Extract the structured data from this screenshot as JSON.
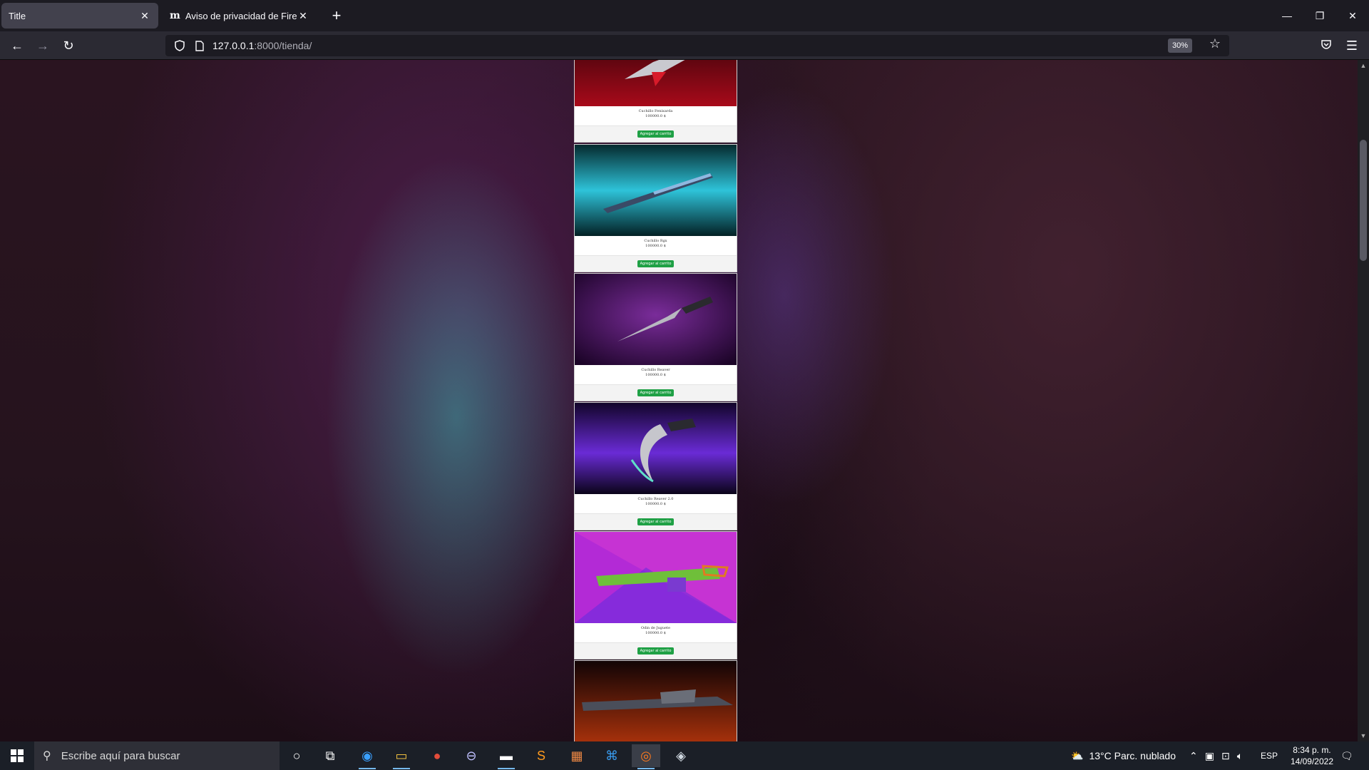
{
  "browser": {
    "tabs": [
      {
        "label": "Title",
        "active": true
      },
      {
        "label": "Aviso de privacidad de Firefox —",
        "favicon": "m"
      }
    ],
    "url_host": "127.0.0.1",
    "url_rest": ":8000/tienda/",
    "zoom": "30%"
  },
  "products": [
    {
      "name": "Cuchillo Fenixarda",
      "price": "100000.0 $",
      "button": "Agregar al carrito",
      "theme": "red"
    },
    {
      "name": "Cuchillo Rgx",
      "price": "100000.0 $",
      "button": "Agregar al carrito",
      "theme": "cyan"
    },
    {
      "name": "Cuchillo Reaver",
      "price": "100000.0 $",
      "button": "Agregar al carrito",
      "theme": "purple"
    },
    {
      "name": "Cuchillo Reaver 2.0",
      "price": "100000.0 $",
      "button": "Agregar al carrito",
      "theme": "violet"
    },
    {
      "name": "Odin de Juguete",
      "price": "100000.0 $",
      "button": "Agregar al carrito",
      "theme": "magenta"
    },
    {
      "name": "",
      "price": "",
      "button": "",
      "theme": "orange"
    }
  ],
  "taskbar": {
    "search_placeholder": "Escribe aquí para buscar",
    "weather": "13°C  Parc. nublado",
    "lang": "ESP",
    "time": "8:34 p. m.",
    "date": "14/09/2022"
  }
}
